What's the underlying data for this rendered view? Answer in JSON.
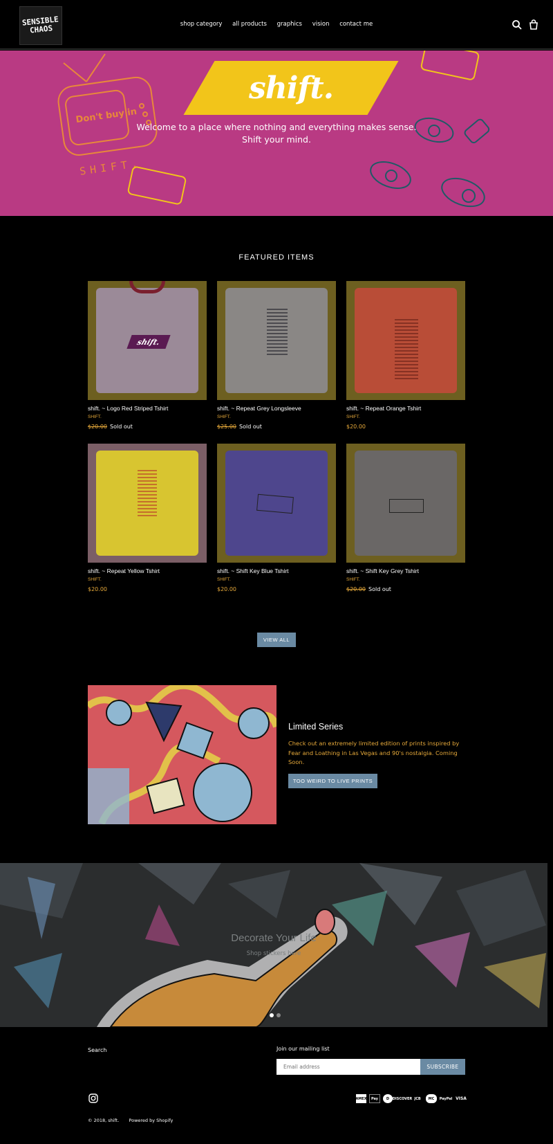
{
  "header": {
    "logo_text": "SENSIBLE CHAOS",
    "nav": [
      "shop category",
      "all products",
      "graphics",
      "vision",
      "contact me"
    ]
  },
  "hero": {
    "brand": "shift.",
    "line1": "Welcome to a place where nothing and everything makes sense.",
    "line2": "Shift your mind.",
    "art_text": "Don't buy in",
    "art_text2": "SHIFT."
  },
  "featured": {
    "title": "FEATURED ITEMS",
    "products": [
      {
        "name": "shift. ~ Logo Red Striped Tshirt",
        "vendor": "SHIFT.",
        "price": "$20.00",
        "sold_out": "Sold out",
        "color": "#9b8a98"
      },
      {
        "name": "shift. ~ Repeat Grey Longsleeve",
        "vendor": "SHIFT.",
        "price": "$25.00",
        "sold_out": "Sold out",
        "color": "#8a8785"
      },
      {
        "name": "shift. ~ Repeat Orange Tshirt",
        "vendor": "SHIFT.",
        "price": "$20.00",
        "sold_out": "",
        "color": "#b94d37"
      },
      {
        "name": "shift. ~ Repeat Yellow Tshirt",
        "vendor": "SHIFT.",
        "price": "$20.00",
        "sold_out": "",
        "color": "#d8c530"
      },
      {
        "name": "shift. ~ Shift Key Blue Tshirt",
        "vendor": "SHIFT.",
        "price": "$20.00",
        "sold_out": "",
        "color": "#4e468d"
      },
      {
        "name": "shift. ~ Shift Key Grey Tshirt",
        "vendor": "SHIFT.",
        "price": "$20.00",
        "sold_out": "Sold out",
        "color": "#6a6766"
      }
    ],
    "view_all": "VIEW ALL"
  },
  "limited": {
    "title": "Limited Series",
    "description": "Check out an extremely limited edition of prints inspired by Fear and Loathing in Las Vegas and 90's nostalgia. Coming Soon.",
    "button": "TOO WEIRD TO LIVE PRINTS"
  },
  "slideshow": {
    "title": "Decorate Your Life",
    "subtitle": "Shop stickers here"
  },
  "footer": {
    "search_link": "Search",
    "mailing_title": "Join our mailing list",
    "email_placeholder": "Email address",
    "subscribe": "SUBSCRIBE",
    "copyright": "© 2018, shift.",
    "powered": "Powered by Shopify",
    "payments": [
      "AMEX",
      "Pay",
      "D",
      "DISCOVER",
      "JCB",
      "MC",
      "PayPal",
      "VISA"
    ]
  },
  "colors": {
    "hero_bg": "#b93a83",
    "badge": "#f2c51a",
    "accent_text": "#e6a93a",
    "button": "#6a8aa3"
  }
}
